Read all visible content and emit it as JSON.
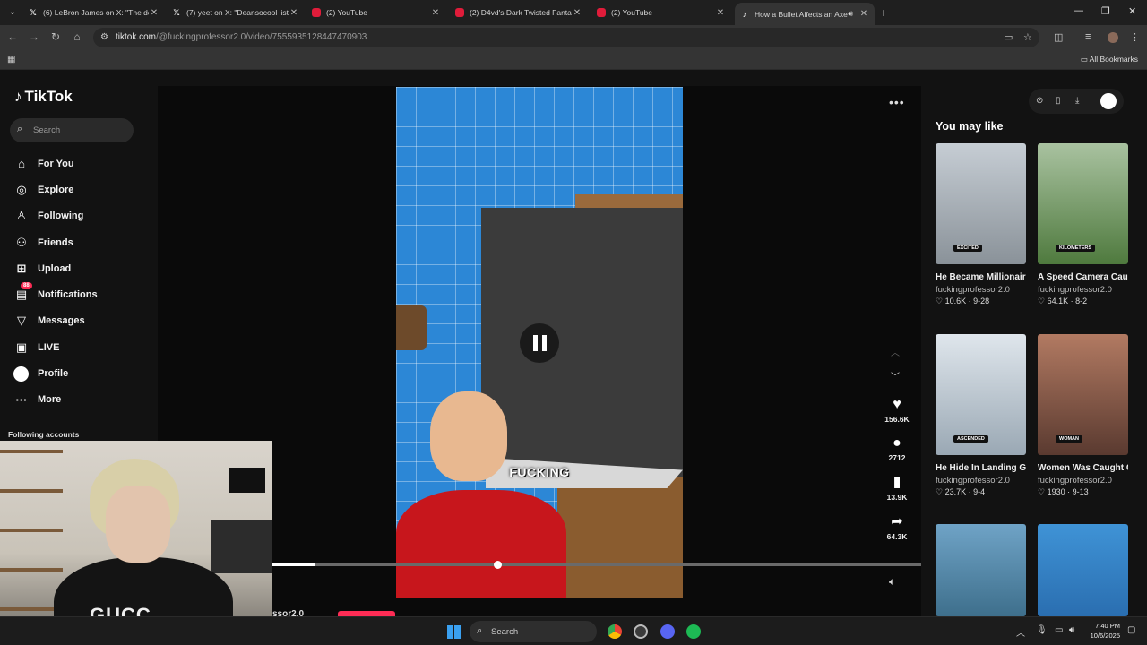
{
  "browser": {
    "tabs": [
      {
        "icon": "x-icon",
        "title": "(6) LeBron James on X: \"The de",
        "active": false
      },
      {
        "icon": "x-icon",
        "title": "(7) yeet on X: \"Deansocool lists",
        "active": false
      },
      {
        "icon": "youtube-icon",
        "title": "(2) YouTube",
        "active": false
      },
      {
        "icon": "youtube-icon",
        "title": "(2) D4vd's Dark Twisted Fantasy",
        "active": false
      },
      {
        "icon": "youtube-icon",
        "title": "(2) YouTube",
        "active": false
      },
      {
        "icon": "tiktok-icon",
        "title": "How a Bullet Affects an Axe",
        "active": true
      }
    ],
    "url_host": "tiktok.com",
    "url_path": "/@fuckingprofessor2.0/video/7555935128447470903",
    "bookmarks_label": "All Bookmarks"
  },
  "sidebar": {
    "logo": "TikTok",
    "search_placeholder": "Search",
    "items": [
      {
        "label": "For You",
        "icon": "home-icon"
      },
      {
        "label": "Explore",
        "icon": "compass-icon"
      },
      {
        "label": "Following",
        "icon": "following-icon"
      },
      {
        "label": "Friends",
        "icon": "friends-icon"
      },
      {
        "label": "Upload",
        "icon": "upload-icon"
      },
      {
        "label": "Notifications",
        "icon": "inbox-icon",
        "badge": "88"
      },
      {
        "label": "Messages",
        "icon": "messages-icon"
      },
      {
        "label": "LIVE",
        "icon": "live-icon"
      },
      {
        "label": "Profile",
        "icon": "profile-avatar"
      },
      {
        "label": "More",
        "icon": "more-icon"
      }
    ],
    "following_accounts": "Following accounts"
  },
  "video": {
    "caption": "FUCKING",
    "progress": 0.065,
    "author_peek": "ssor2.0"
  },
  "actions": {
    "likes": "156.6K",
    "comments": "2712",
    "saves": "13.9K",
    "shares": "64.3K"
  },
  "recommendations": {
    "header": "You may like",
    "cards": [
      {
        "title": "He Became Millionaire Overnig...",
        "author": "fuckingprofessor2.0",
        "likes": "10.6K",
        "date": "9-28",
        "sticker": "EXCITED",
        "bg": "#9aa3ad"
      },
      {
        "title": "A Speed Camera Caught A Pegion ...",
        "author": "fuckingprofessor2.0",
        "likes": "64.1K",
        "date": "8-2",
        "sticker": "KILOMETERS",
        "bg": "#5e8a4a"
      },
      {
        "title": "He Hide In Landing Gear Of Airplane ...",
        "author": "fuckingprofessor2.0",
        "likes": "23.7K",
        "date": "9-4",
        "sticker": "ASCENDED",
        "bg": "#b8c4cf"
      },
      {
        "title": "Women Was Caught Cheating On Her...",
        "author": "fuckingprofessor2.0",
        "likes": "1930",
        "date": "9-13",
        "sticker": "WOMAN",
        "bg": "#8a5a4a"
      },
      {
        "title": "",
        "author": "",
        "likes": "",
        "date": "",
        "sticker": "",
        "bg": "#5a8fb0"
      },
      {
        "title": "",
        "author": "",
        "likes": "",
        "date": "",
        "sticker": "",
        "bg": "#3a86c8"
      }
    ]
  },
  "webcam": {
    "shirt_text": "GUCC"
  },
  "taskbar": {
    "search_placeholder": "Search",
    "time": "7:40 PM",
    "date": "10/6/2025"
  }
}
